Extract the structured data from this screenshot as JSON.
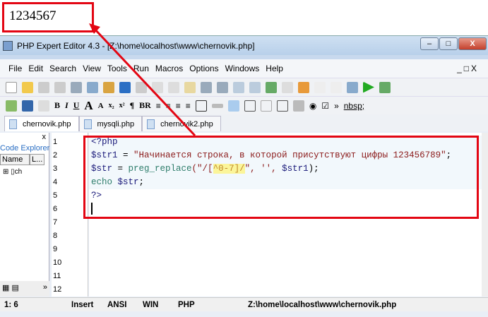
{
  "output": "1234567",
  "window": {
    "title": "PHP Expert Editor 4.3 - [Z:\\home\\localhost\\www\\chernovik.php]",
    "min": "–",
    "max": "□",
    "close": "X"
  },
  "menu": [
    "File",
    "Edit",
    "Search",
    "View",
    "Tools",
    "Run",
    "Macros",
    "Options",
    "Windows",
    "Help"
  ],
  "menu_right": "_□X",
  "toolbar2": {
    "bold": "B",
    "italic": "I",
    "underline": "U",
    "para": "¶",
    "br": "BR",
    "more": "»",
    "nbsp": "nbsp;"
  },
  "tabs": [
    "chernovik.php",
    "mysqli.php",
    "chernovik2.php"
  ],
  "side": {
    "close": "x",
    "title": "Code Explorer",
    "col_name": "Name",
    "col_l": "L...",
    "tree_item": "ch",
    "more": "»"
  },
  "lines": [
    "1",
    "2",
    "3",
    "4",
    "5",
    "6",
    "7",
    "8",
    "9",
    "10",
    "11",
    "12"
  ],
  "code": {
    "l1": "<?php",
    "l2a": "$str1",
    " l2b": "",
    "l2_var": "$str1",
    "l2_eq": " = ",
    "l2_str": "\"Начинается строка, в которой присутствуют цифры 123456789\"",
    "l2_end": ";",
    "l3_var": "$str",
    "l3_eq": " = ",
    "l3_fn": "preg_replace",
    "l3_p": "(\"/[",
    "l3_re": "^0-7]/",
    "l3_rest": "\", '', ",
    "l3_var2": "$str1",
    "l3_end": ");",
    "l4_kw": "echo",
    "l4_var": " $str",
    "l4_end": ";",
    "l5": "?>"
  },
  "status": {
    "pos": "1: 6",
    "mode": "Insert",
    "enc": "ANSI",
    "eol": "WIN",
    "lang": "PHP",
    "path": "Z:\\home\\localhost\\www\\chernovik.php"
  },
  "colors": {
    "annotation": "#e30613"
  }
}
